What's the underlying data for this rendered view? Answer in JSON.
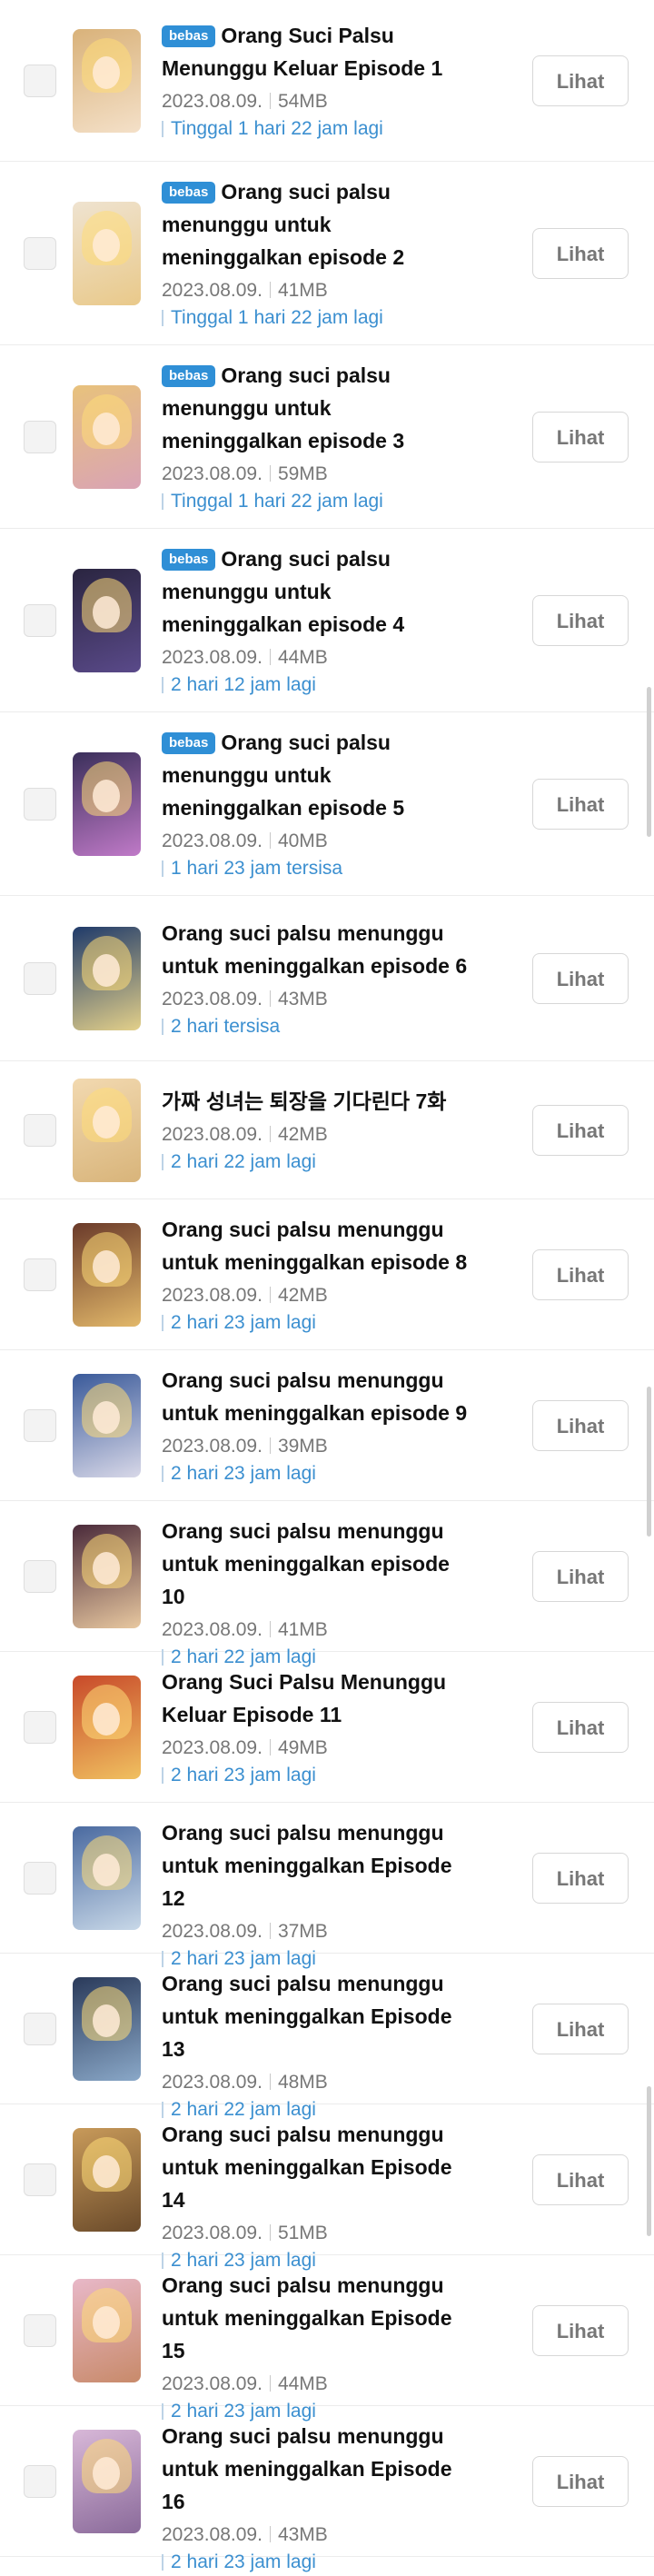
{
  "button_label": "Lihat",
  "badge_label": "bebas",
  "episodes": [
    {
      "title": "Orang Suci Palsu Menunggu Keluar Episode 1",
      "free": true,
      "date": "2023.08.09.",
      "size": "54MB",
      "remaining": "Tinggal 1 hari 22 jam lagi",
      "thumb": [
        "#d9b27a",
        "#f4e0c8"
      ]
    },
    {
      "title": "Orang suci palsu menunggu untuk meninggalkan episode 2",
      "free": true,
      "date": "2023.08.09.",
      "size": "41MB",
      "remaining": "Tinggal 1 hari 22 jam lagi",
      "thumb": [
        "#efe3d0",
        "#e9c98a"
      ]
    },
    {
      "title": "Orang suci palsu menunggu untuk meninggalkan episode 3",
      "free": true,
      "date": "2023.08.09.",
      "size": "59MB",
      "remaining": "Tinggal 1 hari 22 jam lagi",
      "thumb": [
        "#e8c27c",
        "#d9a3b5"
      ]
    },
    {
      "title": "Orang suci palsu menunggu untuk meninggalkan episode 4",
      "free": true,
      "date": "2023.08.09.",
      "size": "44MB",
      "remaining": "2 hari 12 jam lagi",
      "thumb": [
        "#2a2540",
        "#5a4a8a"
      ]
    },
    {
      "title": "Orang suci palsu menunggu untuk meninggalkan episode 5",
      "free": true,
      "date": "2023.08.09.",
      "size": "40MB",
      "remaining": "1 hari 23 jam tersisa",
      "thumb": [
        "#3a2f5a",
        "#c07ac8"
      ]
    },
    {
      "title": "Orang suci palsu menunggu untuk meninggalkan episode 6",
      "free": false,
      "date": "2023.08.09.",
      "size": "43MB",
      "remaining": "2 hari tersisa",
      "thumb": [
        "#1f3a6a",
        "#e3d08a"
      ]
    },
    {
      "title": "가짜 성녀는 퇴장을 기다린다 7화",
      "free": false,
      "date": "2023.08.09.",
      "size": "42MB",
      "remaining": "2 hari 22 jam lagi",
      "thumb": [
        "#f2d9b0",
        "#d8b47a"
      ]
    },
    {
      "title": "Orang suci palsu menunggu untuk meninggalkan episode 8",
      "free": false,
      "date": "2023.08.09.",
      "size": "42MB",
      "remaining": "2 hari 23 jam lagi",
      "thumb": [
        "#6a3a2a",
        "#e2b86a"
      ]
    },
    {
      "title": "Orang suci palsu menunggu untuk meninggalkan episode 9",
      "free": false,
      "date": "2023.08.09.",
      "size": "39MB",
      "remaining": "2 hari 23 jam lagi",
      "thumb": [
        "#3a5a9a",
        "#d8d8e8"
      ]
    },
    {
      "title": "Orang suci palsu menunggu untuk meninggalkan episode 10",
      "free": false,
      "date": "2023.08.09.",
      "size": "41MB",
      "remaining": "2 hari 22 jam lagi",
      "thumb": [
        "#4a2a3a",
        "#e8c8a0"
      ]
    },
    {
      "title": "Orang Suci Palsu Menunggu Keluar Episode 11",
      "free": false,
      "date": "2023.08.09.",
      "size": "49MB",
      "remaining": "2 hari 23 jam lagi",
      "thumb": [
        "#c84a2a",
        "#f0c060"
      ]
    },
    {
      "title": "Orang suci palsu menunggu untuk meninggalkan Episode 12",
      "free": false,
      "date": "2023.08.09.",
      "size": "37MB",
      "remaining": "2 hari 23 jam lagi",
      "thumb": [
        "#4a6aa0",
        "#c8d8e8"
      ]
    },
    {
      "title": "Orang suci palsu menunggu untuk meninggalkan Episode 13",
      "free": false,
      "date": "2023.08.09.",
      "size": "48MB",
      "remaining": "2 hari 22 jam lagi",
      "thumb": [
        "#2a3a5a",
        "#8aa8c8"
      ]
    },
    {
      "title": "Orang suci palsu menunggu untuk meninggalkan Episode 14",
      "free": false,
      "date": "2023.08.09.",
      "size": "51MB",
      "remaining": "2 hari 23 jam lagi",
      "thumb": [
        "#c89a5a",
        "#6a4a2a"
      ]
    },
    {
      "title": "Orang suci palsu menunggu untuk meninggalkan Episode 15",
      "free": false,
      "date": "2023.08.09.",
      "size": "44MB",
      "remaining": "2 hari 23 jam lagi",
      "thumb": [
        "#e8b8c8",
        "#c88a6a"
      ]
    },
    {
      "title": "Orang suci palsu menunggu untuk meninggalkan Episode 16",
      "free": false,
      "date": "2023.08.09.",
      "size": "43MB",
      "remaining": "2 hari 23 jam lagi",
      "thumb": [
        "#d8b8d8",
        "#8a6a9a"
      ]
    }
  ]
}
